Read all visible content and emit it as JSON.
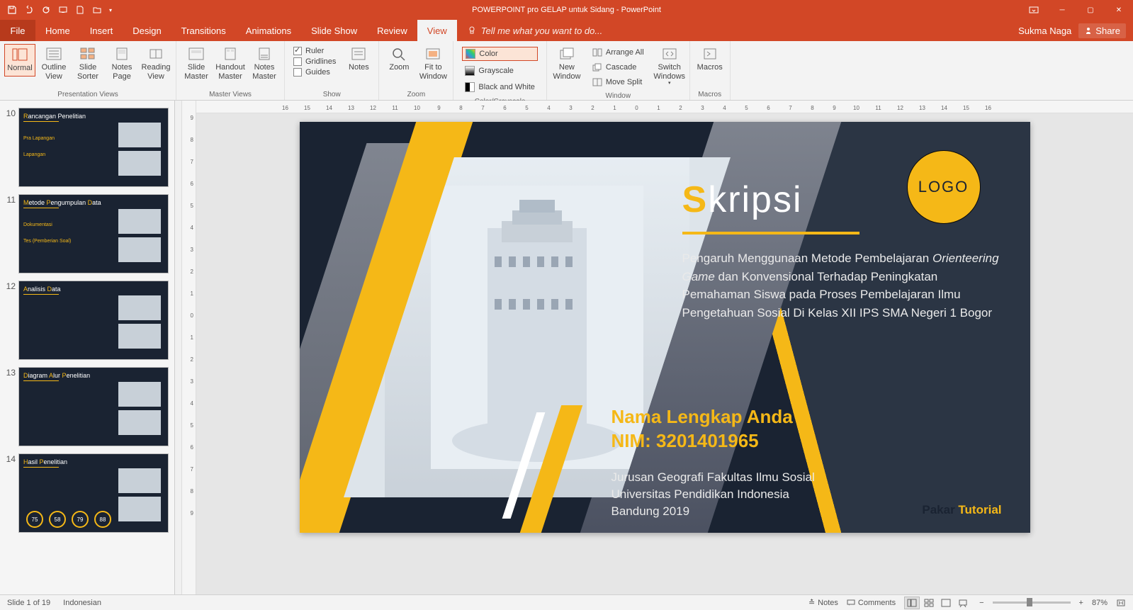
{
  "title": "POWERPOINT pro GELAP untuk Sidang - PowerPoint",
  "user": "Sukma Naga",
  "share": "Share",
  "tabs": {
    "file": "File",
    "home": "Home",
    "insert": "Insert",
    "design": "Design",
    "transitions": "Transitions",
    "animations": "Animations",
    "slideshow": "Slide Show",
    "review": "Review",
    "view": "View"
  },
  "tellme": "Tell me what you want to do...",
  "ribbon": {
    "normal": "Normal",
    "outline": "Outline View",
    "sorter": "Slide Sorter",
    "notespage": "Notes Page",
    "reading": "Reading View",
    "g1": "Presentation Views",
    "smaster": "Slide Master",
    "hmaster": "Handout Master",
    "nmaster": "Notes Master",
    "g2": "Master Views",
    "ruler": "Ruler",
    "gridlines": "Gridlines",
    "guides": "Guides",
    "g3": "Show",
    "notes": "Notes",
    "zoom": "Zoom",
    "fit": "Fit to Window",
    "g4": "Zoom",
    "color": "Color",
    "grayscale": "Grayscale",
    "bw": "Black and White",
    "g5": "Color/Grayscale",
    "newwin": "New Window",
    "arrange": "Arrange All",
    "cascade": "Cascade",
    "movesplit": "Move Split",
    "g6": "Window",
    "switch": "Switch Windows",
    "macros": "Macros",
    "g7": "Macros"
  },
  "thumbs": [
    {
      "num": "10",
      "title_y": "R",
      "title": "ancangan Penelitian",
      "sub1": "Pra Lapangan",
      "sub2": "Lapangan"
    },
    {
      "num": "11",
      "title_y": "M",
      "title": "etode ",
      "title_y2": "P",
      "title2": "engumpulan ",
      "title_y3": "D",
      "title3": "ata",
      "sub1": "Dokumentasi",
      "sub2": "Tes (Pemberian Soal)"
    },
    {
      "num": "12",
      "title_y": "A",
      "title": "nalisis ",
      "title_y2": "D",
      "title2": "ata"
    },
    {
      "num": "13",
      "title_y": "D",
      "title": "iagram ",
      "title_y2": "A",
      "title2": "lur ",
      "title_y3": "P",
      "title3": "enelitian"
    },
    {
      "num": "14",
      "title_y": "H",
      "title": "asil ",
      "title_y2": "P",
      "title2": "enelitian",
      "nums": [
        "75",
        "58",
        "79",
        "88"
      ]
    }
  ],
  "slide": {
    "logo": "LOGO",
    "title_y": "S",
    "title": "kripsi",
    "desc_pre": "Pengaruh Menggunaan Metode Pembelajaran ",
    "desc_em": "Orienteering Game",
    "desc_post": " dan Konvensional Terhadap Peningkatan Pemahaman Siswa pada Proses Pembelajaran Ilmu Pengetahuan Sosial Di Kelas XII IPS SMA Negeri 1 Bogor",
    "name": "Nama Lengkap Anda",
    "nim": "NIM: 3201401965",
    "dept1": "Jurusan Geografi  Fakultas Ilmu Sosial",
    "dept2": "Universitas Pendidikan Indonesia",
    "dept3": "Bandung 2019",
    "tut1": "Pakar ",
    "tut2": "Tutorial"
  },
  "status": {
    "slide": "Slide 1 of 19",
    "lang": "Indonesian",
    "notes": "Notes",
    "comments": "Comments",
    "zoom": "87%"
  },
  "hruler": [
    "16",
    "15",
    "14",
    "13",
    "12",
    "11",
    "10",
    "9",
    "8",
    "7",
    "6",
    "5",
    "4",
    "3",
    "2",
    "1",
    "0",
    "1",
    "2",
    "3",
    "4",
    "5",
    "6",
    "7",
    "8",
    "9",
    "10",
    "11",
    "12",
    "13",
    "14",
    "15",
    "16"
  ],
  "vruler": [
    "9",
    "8",
    "7",
    "6",
    "5",
    "4",
    "3",
    "2",
    "1",
    "0",
    "1",
    "2",
    "3",
    "4",
    "5",
    "6",
    "7",
    "8",
    "9"
  ]
}
